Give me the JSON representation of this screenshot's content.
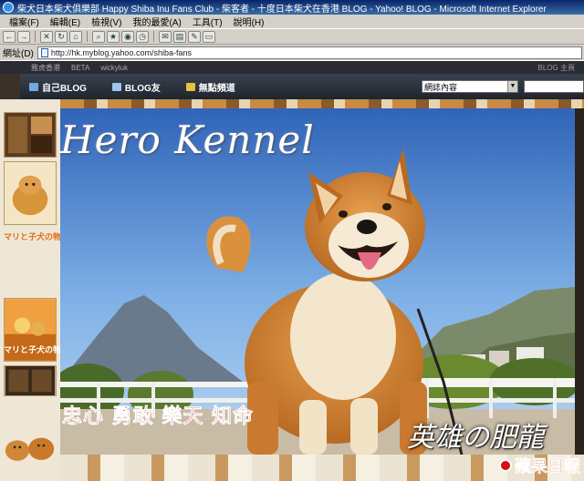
{
  "window": {
    "title": "柴犬日本柴犬俱樂部 Happy Shiba Inu Fans Club - 柴客者 - 十度日本柴犬在香港 BLOG - Yahoo! BLOG - Microsoft Internet Explorer"
  },
  "menubar": {
    "items": [
      {
        "label": "檔案(F)"
      },
      {
        "label": "編輯(E)"
      },
      {
        "label": "檢視(V)"
      },
      {
        "label": "我的最愛(A)"
      },
      {
        "label": "工具(T)"
      },
      {
        "label": "說明(H)"
      }
    ]
  },
  "toolbar": {
    "back_label": "←",
    "forward_label": "→"
  },
  "address": {
    "label": "網址(D)",
    "url": "http://hk.myblog.yahoo.com/shiba-fans"
  },
  "yahoo_top": {
    "brand": "雅虎香港",
    "beta": "BETA",
    "user": "wickyluk",
    "right_text": "BLOG 主頁"
  },
  "navbar": {
    "my_blog": "自己BLOG",
    "blog_friends": "BLOG友",
    "channels": "無點頻道",
    "search_scope": "網誌內容"
  },
  "sidebar": {
    "promo_1": "マリと子犬の物",
    "promo_2": "マリと子犬の物"
  },
  "banner": {
    "title": "Hero Kennel",
    "motto": "忠心 勇敢 樂天 知命",
    "dog_name": "英雄の肥龍"
  },
  "watermark": {
    "text": "蘋果日報"
  },
  "colors": {
    "title_bar": "#0a246a",
    "navbar": "#2a303a",
    "motto": "#b41808",
    "watermark": "#c80000"
  }
}
